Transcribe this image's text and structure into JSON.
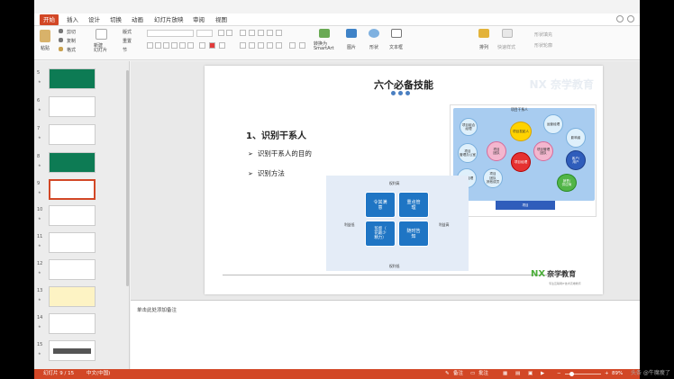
{
  "tabs": [
    "开始",
    "插入",
    "设计",
    "切换",
    "动画",
    "幻灯片放映",
    "审阅",
    "视图"
  ],
  "ribbon": {
    "paste": "粘贴",
    "cut": "剪切",
    "copy": "复制",
    "format": "格式",
    "new_slide": "新建\n幻灯片",
    "layout": "版式",
    "reset": "重置",
    "section": "节",
    "convert": "转换为\nSmartArt",
    "picture": "图片",
    "shape": "形状",
    "textbox": "文本框",
    "arrange": "排列",
    "quick_styles": "快速样式",
    "shape_fill": "形状填充",
    "shape_outline": "形状轮廓"
  },
  "thumbnails": [
    {
      "num": "5",
      "style": "green"
    },
    {
      "num": "6",
      "style": "white"
    },
    {
      "num": "7",
      "style": "white"
    },
    {
      "num": "8",
      "style": "green"
    },
    {
      "num": "9",
      "style": "selected"
    },
    {
      "num": "10",
      "style": "white"
    },
    {
      "num": "11",
      "style": "white"
    },
    {
      "num": "12",
      "style": "white"
    },
    {
      "num": "13",
      "style": "white"
    },
    {
      "num": "14",
      "style": "white"
    },
    {
      "num": "15",
      "style": "dark"
    }
  ],
  "slide": {
    "title": "六个必备技能",
    "heading": "1、识别干系人",
    "bullets": [
      "识别干系人的目的",
      "识别方法"
    ],
    "watermark": "NX 奈学教育",
    "diagram1": {
      "tag": "项目干系人",
      "bottom": "项目",
      "nodes": [
        "项目组合\n经理",
        "运营经理",
        "影响者",
        "项目发起人",
        "项目\n团队",
        "项目\n管理办公室",
        "客户/\n用户",
        "销售/\n供应商",
        "职能经理",
        "项目管理\n团队",
        "项目经理",
        "项目\n团队\n其他成员"
      ]
    },
    "diagram2": {
      "top": "权利高",
      "bottom": "权利低",
      "left": "利益低",
      "right": "利益高",
      "quads": [
        "令其满\n意",
        "重点管\n理",
        "监督（\n花最少\n精力）",
        "随时告\n知"
      ]
    },
    "logo": "NX",
    "logo_name": "奈学教育",
    "logo_sub": "专注互联网IT技术高端教育"
  },
  "notes_placeholder": "单击此处添加备注",
  "status": {
    "slide_pos": "幻灯片 9 / 15",
    "language": "中文(中国)",
    "notes_btn": "备注",
    "comments_btn": "批注",
    "zoom": "89%"
  },
  "corner_watermark": "头条 @牛魔瘦了"
}
